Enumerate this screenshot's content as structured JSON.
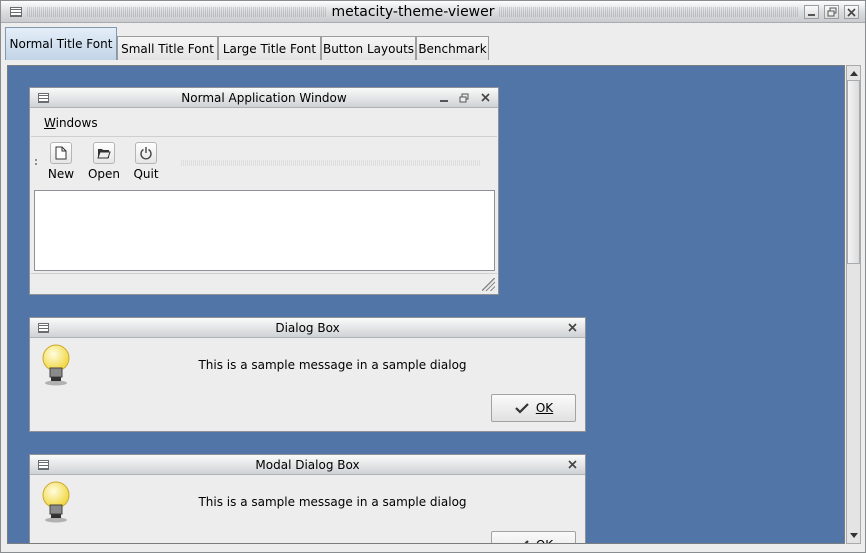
{
  "window": {
    "title": "metacity-theme-viewer"
  },
  "tabs": [
    {
      "label": "Normal Title Font",
      "active": true
    },
    {
      "label": "Small Title Font",
      "active": false
    },
    {
      "label": "Large Title Font",
      "active": false
    },
    {
      "label": "Button Layouts",
      "active": false
    },
    {
      "label": "Benchmark",
      "active": false
    }
  ],
  "normal_window": {
    "title": "Normal Application Window",
    "menu": {
      "windows_label": "Windows"
    },
    "toolbar": {
      "new_label": "New",
      "open_label": "Open",
      "quit_label": "Quit"
    }
  },
  "dialog": {
    "title": "Dialog Box",
    "message": "This is a sample message in a sample dialog",
    "ok_label": "OK"
  },
  "modal_dialog": {
    "title": "Modal Dialog Box",
    "message": "This is a sample message in a sample dialog",
    "ok_label": "OK"
  },
  "colors": {
    "viewport_bg": "#5175a6",
    "active_tab": "#c2d4e8"
  }
}
